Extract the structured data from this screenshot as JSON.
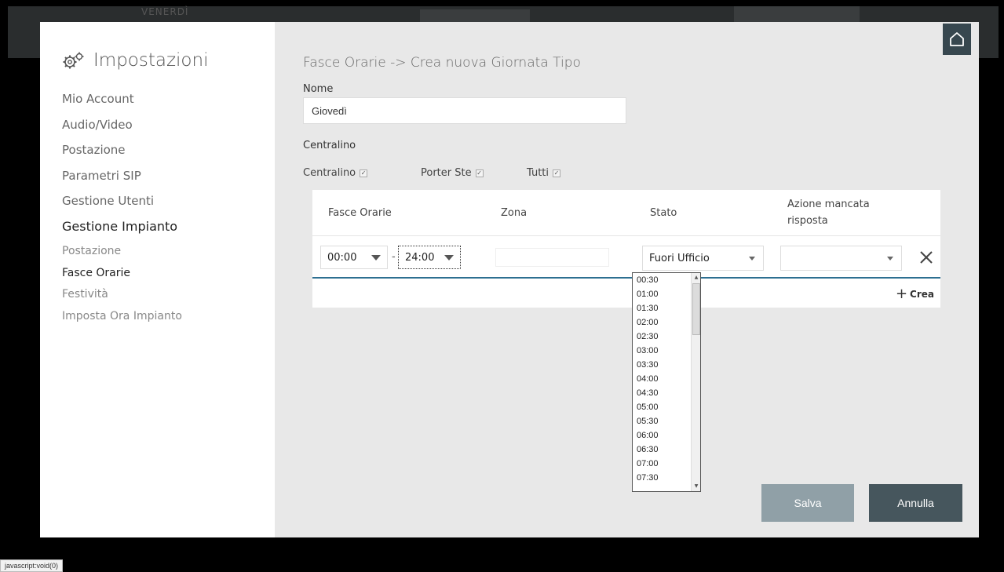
{
  "backdrop": {
    "day_text": "VENERDÌ"
  },
  "sidebar": {
    "title": "Impostazioni",
    "items": [
      {
        "label": "Mio Account",
        "active": false
      },
      {
        "label": "Audio/Video",
        "active": false
      },
      {
        "label": "Postazione",
        "active": false
      },
      {
        "label": "Parametri SIP",
        "active": false
      },
      {
        "label": "Gestione Utenti",
        "active": false
      },
      {
        "label": "Gestione Impianto",
        "active": true
      }
    ],
    "subitems": [
      {
        "label": "Postazione",
        "active": false
      },
      {
        "label": "Fasce Orarie",
        "active": true
      },
      {
        "label": "Festività",
        "active": false
      },
      {
        "label": "Imposta Ora Impianto",
        "active": false
      }
    ]
  },
  "main": {
    "title": "Fasce Orarie -> Crea nuova Giornata Tipo",
    "name_label": "Nome",
    "name_value": "Giovedì",
    "centralino_label": "Centralino",
    "checkboxes": [
      {
        "label": "Centralino",
        "checked": true
      },
      {
        "label": "Porter Ste",
        "checked": true
      },
      {
        "label": "Tutti",
        "checked": true
      }
    ],
    "table": {
      "headers": [
        "Fasce Orarie",
        "Zona",
        "Stato",
        "Azione mancata risposta"
      ],
      "row": {
        "from": "00:00",
        "to": "24:00",
        "separator": "-",
        "zona": "",
        "stato": "Fuori Ufficio",
        "azione": ""
      },
      "add_label": "Crea"
    },
    "dropdown_options": [
      "00:30",
      "01:00",
      "01:30",
      "02:00",
      "02:30",
      "03:00",
      "03:30",
      "04:00",
      "04:30",
      "05:00",
      "05:30",
      "06:00",
      "06:30",
      "07:00",
      "07:30"
    ],
    "save_label": "Salva",
    "cancel_label": "Annulla"
  },
  "statusbar": {
    "text": "javascript:void(0)"
  },
  "colors": {
    "accent": "#2d6f91",
    "button_save": "#90a0a7",
    "button_cancel": "#46565d",
    "home": "#37474f"
  }
}
